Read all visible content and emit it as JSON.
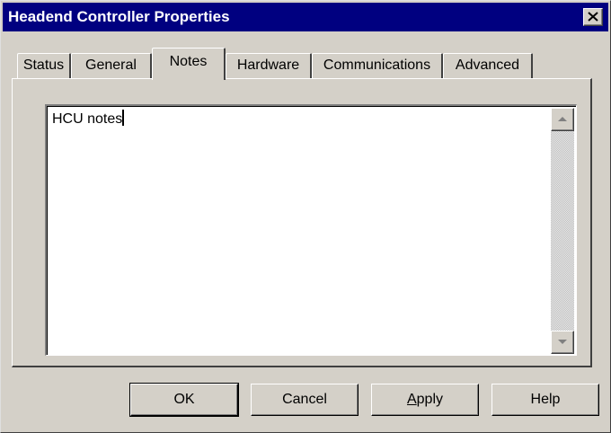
{
  "window": {
    "title": "Headend Controller Properties"
  },
  "tabs": [
    {
      "label": "Status"
    },
    {
      "label": "General"
    },
    {
      "label": "Notes",
      "active": true
    },
    {
      "label": "Hardware"
    },
    {
      "label": "Communications"
    },
    {
      "label": "Advanced"
    }
  ],
  "notes": {
    "value": "HCU notes"
  },
  "buttons": {
    "ok": "OK",
    "cancel": "Cancel",
    "apply_rest": "pply",
    "apply_access": "A",
    "help": "Help"
  },
  "icons": {
    "close": "close-icon",
    "scroll_up": "arrow-up-icon",
    "scroll_down": "arrow-down-icon"
  },
  "colors": {
    "titlebar": "#000080",
    "face": "#d4d0c8"
  }
}
